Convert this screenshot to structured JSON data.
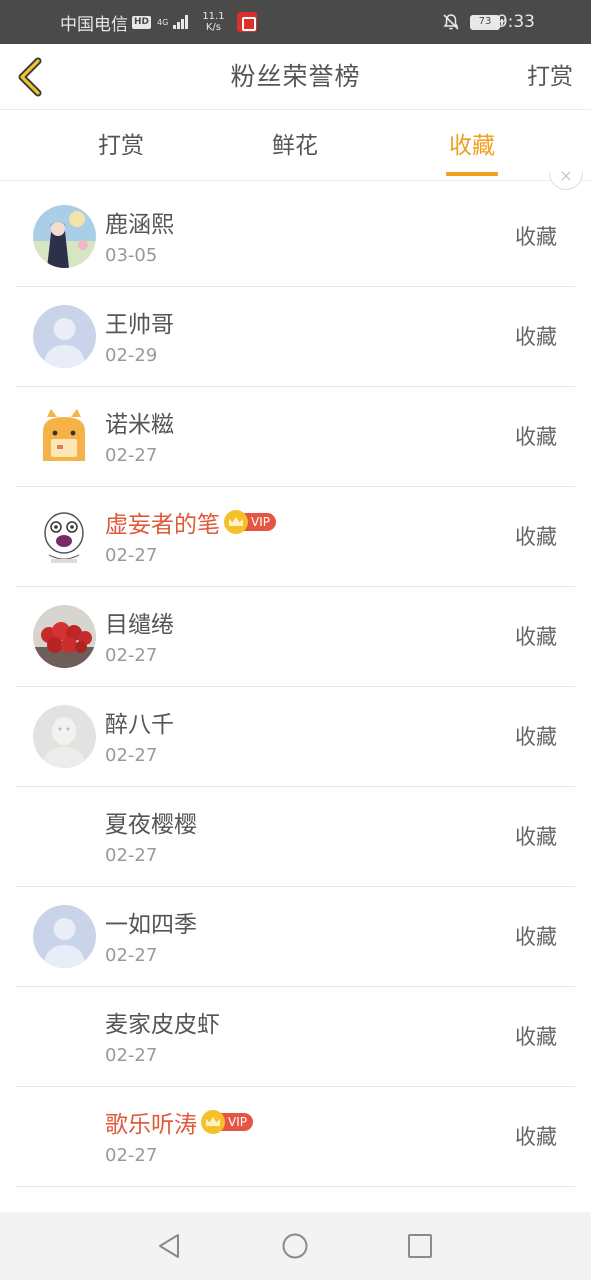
{
  "status_bar": {
    "carrier": "中国电信",
    "hd": "HD",
    "network": "4G",
    "speed_value": "11.1",
    "speed_unit": "K/s",
    "battery": "73",
    "time": "9:33"
  },
  "header": {
    "title": "粉丝荣誉榜",
    "action": "打赏"
  },
  "tabs": [
    {
      "label": "打赏",
      "active": false
    },
    {
      "label": "鲜花",
      "active": false
    },
    {
      "label": "收藏",
      "active": true
    }
  ],
  "accent_color": "#f0a020",
  "vip_name_color": "#e05a3a",
  "fans": [
    {
      "name": "鹿涵熙",
      "date": "03-05",
      "action": "收藏",
      "vip": false,
      "avatar": "anime-avatar"
    },
    {
      "name": "王帅哥",
      "date": "02-29",
      "action": "收藏",
      "vip": false,
      "avatar": "default-avatar"
    },
    {
      "name": "诺米糍",
      "date": "02-27",
      "action": "收藏",
      "vip": false,
      "avatar": "cartoon-bag-avatar"
    },
    {
      "name": "虚妄者的笔",
      "date": "02-27",
      "action": "收藏",
      "vip": true,
      "vip_label": "VIP",
      "avatar": "meme-face-avatar"
    },
    {
      "name": "目缱绻",
      "date": "02-27",
      "action": "收藏",
      "vip": false,
      "avatar": "strawberries-avatar"
    },
    {
      "name": "醉八千",
      "date": "02-27",
      "action": "收藏",
      "vip": false,
      "avatar": "faded-portrait-avatar"
    },
    {
      "name": "夏夜樱樱",
      "date": "02-27",
      "action": "收藏",
      "vip": false,
      "avatar": "none"
    },
    {
      "name": "一如四季",
      "date": "02-27",
      "action": "收藏",
      "vip": false,
      "avatar": "default-avatar"
    },
    {
      "name": "麦家皮皮虾",
      "date": "02-27",
      "action": "收藏",
      "vip": false,
      "avatar": "none"
    },
    {
      "name": "歌乐听涛",
      "date": "02-27",
      "action": "收藏",
      "vip": true,
      "vip_label": "VIP",
      "avatar": "none"
    }
  ],
  "nav_bar": {
    "back": "back-triangle-icon",
    "home": "home-circle-icon",
    "recents": "recents-square-icon"
  }
}
